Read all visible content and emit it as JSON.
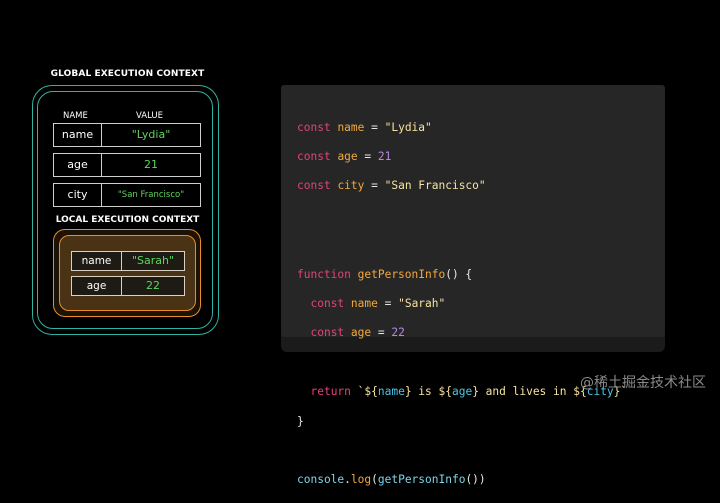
{
  "global": {
    "title": "GLOBAL EXECUTION CONTEXT",
    "col_name": "NAME",
    "col_value": "VALUE",
    "vars": [
      {
        "name": "name",
        "value": "\"Lydia\""
      },
      {
        "name": "age",
        "value": "21"
      },
      {
        "name": "city",
        "value": "\"San Francisco\""
      }
    ]
  },
  "local": {
    "title": "LOCAL EXECUTION CONTEXT",
    "vars": [
      {
        "name": "name",
        "value": "\"Sarah\""
      },
      {
        "name": "age",
        "value": "22"
      }
    ]
  },
  "code": {
    "l1": {
      "kw": "const",
      "var": "name",
      "eq": " = ",
      "val": "\"Lydia\""
    },
    "l2": {
      "kw": "const",
      "var": "age",
      "eq": " = ",
      "val": "21"
    },
    "l3": {
      "kw": "const",
      "var": "city",
      "eq": " = ",
      "val": "\"San Francisco\""
    },
    "l4": {
      "kw": "function",
      "fn": "getPersonInfo",
      "rest": "() {"
    },
    "l5": {
      "kw": "const",
      "var": "name",
      "eq": " = ",
      "val": "\"Sarah\""
    },
    "l6": {
      "kw": "const",
      "var": "age",
      "eq": " = ",
      "val": "22"
    },
    "l7": {
      "kw": "return",
      "t1": "`${",
      "v1": "name",
      "t2": "} is ${",
      "v2": "age",
      "t3": "} and lives in ${",
      "v3": "city",
      "t4": "}`"
    },
    "l8": "}",
    "l9": {
      "obj": "console",
      "dot": ".",
      "fn": "log",
      "p1": "(",
      "call": "getPersonInfo",
      "p2": "())"
    }
  },
  "colors": {
    "global_border": "#2fb3a3",
    "local_border": "#e98d2a",
    "value_green": "#5fd35f",
    "keyword": "#e0427d",
    "variable": "#f2a83b",
    "string": "#f6e3a1",
    "number": "#b586e6"
  },
  "watermark": "@稀土掘金技术社区"
}
